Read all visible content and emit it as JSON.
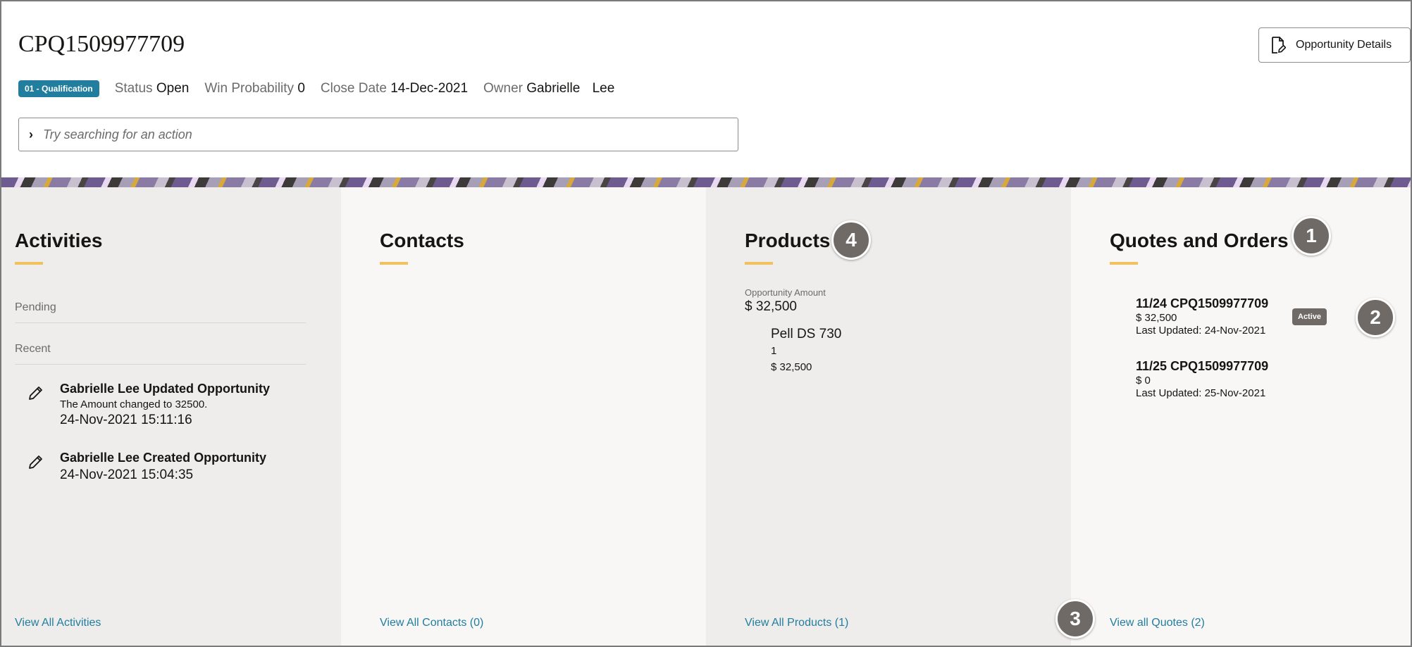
{
  "header": {
    "title": "CPQ1509977709",
    "stage_badge": "01 - Qualification",
    "status_label": "Status",
    "status_value": "Open",
    "win_label": "Win Probability",
    "win_value": "0",
    "close_label": "Close Date",
    "close_value": "14-Dec-2021",
    "owner_label": "Owner",
    "owner_first": "Gabrielle",
    "owner_last": "Lee",
    "search_placeholder": "Try searching for an action",
    "details_button": "Opportunity Details"
  },
  "activities": {
    "title": "Activities",
    "pending_label": "Pending",
    "recent_label": "Recent",
    "items": [
      {
        "title": "Gabrielle Lee Updated Opportunity",
        "subtitle": "The Amount changed to 32500.",
        "date": "24-Nov-2021 15:11:16"
      },
      {
        "title": "Gabrielle Lee Created Opportunity",
        "date": "24-Nov-2021 15:04:35"
      }
    ],
    "view_all": "View All Activities"
  },
  "contacts": {
    "title": "Contacts",
    "view_all": "View All Contacts (0)"
  },
  "products": {
    "title": "Products",
    "amount_label": "Opportunity Amount",
    "amount_value": "$ 32,500",
    "items": [
      {
        "name": "Pell DS 730",
        "qty": "1",
        "price": "$ 32,500"
      }
    ],
    "view_all": "View All Products (1)"
  },
  "quotes": {
    "title": "Quotes and Orders",
    "items": [
      {
        "title": "11/24 CPQ1509977709",
        "amount": "$ 32,500",
        "updated": "Last Updated: 24-Nov-2021",
        "badge": "Active"
      },
      {
        "title": "11/25 CPQ1509977709",
        "amount": "$ 0",
        "updated": "Last Updated: 25-Nov-2021"
      }
    ],
    "view_all": "View all Quotes (2)"
  },
  "callouts": [
    "1",
    "2",
    "3",
    "4"
  ],
  "colors": {
    "accent_link": "#227e9e",
    "badge_bg": "#227e9e",
    "underline": "#f0c15d",
    "callout_bg": "#6f6a65"
  }
}
